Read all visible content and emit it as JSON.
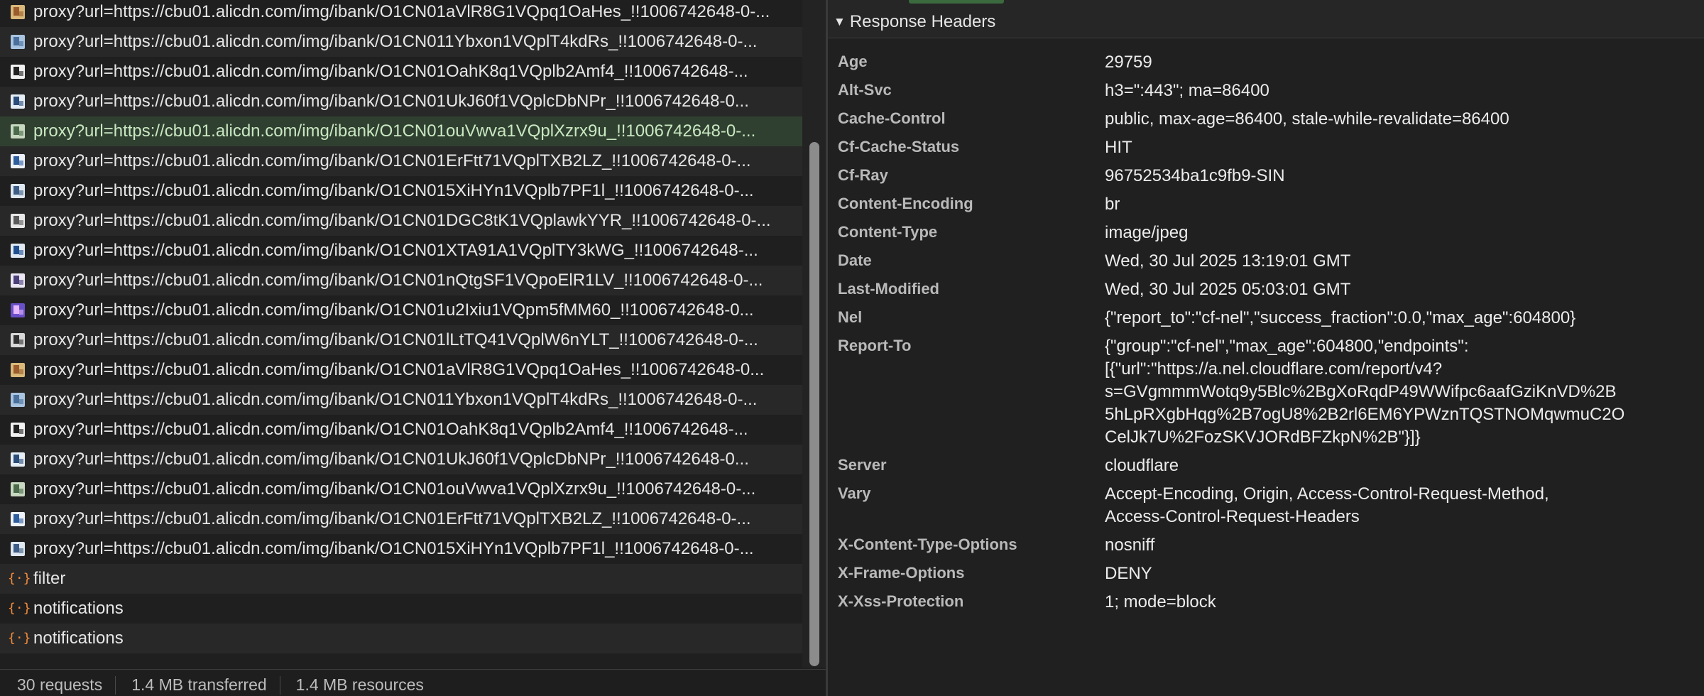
{
  "requests": [
    {
      "name": "proxy?url=https://cbu01.alicdn.com/img/ibank/O1CN01aVlR8G1VQpq1OaHes_!!1006742648-0-...",
      "icon": "image-thumb-icon"
    },
    {
      "name": "proxy?url=https://cbu01.alicdn.com/img/ibank/O1CN011Ybxon1VQplT4kdRs_!!1006742648-0-...",
      "icon": "image-thumb-icon"
    },
    {
      "name": "proxy?url=https://cbu01.alicdn.com/img/ibank/O1CN01OahK8q1VQplb2Amf4_!!1006742648-...",
      "icon": "image-thumb-icon"
    },
    {
      "name": "proxy?url=https://cbu01.alicdn.com/img/ibank/O1CN01UkJ60f1VQplcDbNPr_!!1006742648-0...",
      "icon": "image-thumb-icon"
    },
    {
      "name": "proxy?url=https://cbu01.alicdn.com/img/ibank/O1CN01ouVwva1VQplXzrx9u_!!1006742648-0-...",
      "icon": "image-thumb-icon"
    },
    {
      "name": "proxy?url=https://cbu01.alicdn.com/img/ibank/O1CN01ErFtt71VQplTXB2LZ_!!1006742648-0-...",
      "icon": "image-thumb-icon"
    },
    {
      "name": "proxy?url=https://cbu01.alicdn.com/img/ibank/O1CN015XiHYn1VQplb7PF1l_!!1006742648-0-...",
      "icon": "image-thumb-icon"
    },
    {
      "name": "proxy?url=https://cbu01.alicdn.com/img/ibank/O1CN01DGC8tK1VQplawkYYR_!!1006742648-0-...",
      "icon": "image-thumb-icon"
    },
    {
      "name": "proxy?url=https://cbu01.alicdn.com/img/ibank/O1CN01XTA91A1VQplTY3kWG_!!1006742648-...",
      "icon": "image-thumb-icon"
    },
    {
      "name": "proxy?url=https://cbu01.alicdn.com/img/ibank/O1CN01nQtgSF1VQpoElR1LV_!!1006742648-0-...",
      "icon": "image-thumb-icon"
    },
    {
      "name": "proxy?url=https://cbu01.alicdn.com/img/ibank/O1CN01u2Ixiu1VQpm5fMM60_!!1006742648-0...",
      "icon": "image-thumb-icon"
    },
    {
      "name": "proxy?url=https://cbu01.alicdn.com/img/ibank/O1CN01lLtTQ41VQplW6nYLT_!!1006742648-0-...",
      "icon": "image-thumb-icon"
    },
    {
      "name": "proxy?url=https://cbu01.alicdn.com/img/ibank/O1CN01aVlR8G1VQpq1OaHes_!!1006742648-0...",
      "icon": "image-thumb-icon"
    },
    {
      "name": "proxy?url=https://cbu01.alicdn.com/img/ibank/O1CN011Ybxon1VQplT4kdRs_!!1006742648-0-...",
      "icon": "image-thumb-icon"
    },
    {
      "name": "proxy?url=https://cbu01.alicdn.com/img/ibank/O1CN01OahK8q1VQplb2Amf4_!!1006742648-...",
      "icon": "image-thumb-icon"
    },
    {
      "name": "proxy?url=https://cbu01.alicdn.com/img/ibank/O1CN01UkJ60f1VQplcDbNPr_!!1006742648-0...",
      "icon": "image-thumb-icon"
    },
    {
      "name": "proxy?url=https://cbu01.alicdn.com/img/ibank/O1CN01ouVwva1VQplXzrx9u_!!1006742648-0-...",
      "icon": "image-thumb-icon"
    },
    {
      "name": "proxy?url=https://cbu01.alicdn.com/img/ibank/O1CN01ErFtt71VQplTXB2LZ_!!1006742648-0-...",
      "icon": "image-thumb-icon"
    },
    {
      "name": "proxy?url=https://cbu01.alicdn.com/img/ibank/O1CN015XiHYn1VQplb7PF1l_!!1006742648-0-...",
      "icon": "image-thumb-icon"
    },
    {
      "name": "filter",
      "icon": "json-braces-icon"
    },
    {
      "name": "notifications",
      "icon": "json-braces-icon"
    },
    {
      "name": "notifications",
      "icon": "json-braces-icon"
    }
  ],
  "selected_index": 4,
  "status_bar": {
    "requests": "30 requests",
    "transferred": "1.4 MB transferred",
    "resources": "1.4 MB resources"
  },
  "response_headers": {
    "title": "Response Headers",
    "items": [
      {
        "key": "Age",
        "value": "29759"
      },
      {
        "key": "Alt-Svc",
        "value": "h3=\":443\"; ma=86400"
      },
      {
        "key": "Cache-Control",
        "value": "public, max-age=86400, stale-while-revalidate=86400"
      },
      {
        "key": "Cf-Cache-Status",
        "value": "HIT"
      },
      {
        "key": "Cf-Ray",
        "value": "96752534ba1c9fb9-SIN"
      },
      {
        "key": "Content-Encoding",
        "value": "br"
      },
      {
        "key": "Content-Type",
        "value": "image/jpeg"
      },
      {
        "key": "Date",
        "value": "Wed, 30 Jul 2025 13:19:01 GMT"
      },
      {
        "key": "Last-Modified",
        "value": "Wed, 30 Jul 2025 05:03:01 GMT"
      },
      {
        "key": "Nel",
        "value": "{\"report_to\":\"cf-nel\",\"success_fraction\":0.0,\"max_age\":604800}"
      },
      {
        "key": "Report-To",
        "value": "{\"group\":\"cf-nel\",\"max_age\":604800,\"endpoints\":\n[{\"url\":\"https://a.nel.cloudflare.com/report/v4?\ns=GVgmmmWotq9y5Blc%2BgXoRqdP49WWifpc6aafGziKnVD%2B\n5hLpRXgbHqg%2B7ogU8%2B2rl6EM6YPWznTQSTNOMqwmuC2O\nCelJk7U%2FozSKVJORdBFZkpN%2B\"}]}"
      },
      {
        "key": "Server",
        "value": "cloudflare"
      },
      {
        "key": "Vary",
        "value": "Accept-Encoding, Origin, Access-Control-Request-Method,\nAccess-Control-Request-Headers"
      },
      {
        "key": "X-Content-Type-Options",
        "value": "nosniff"
      },
      {
        "key": "X-Frame-Options",
        "value": "DENY"
      },
      {
        "key": "X-Xss-Protection",
        "value": "1; mode=block"
      }
    ]
  },
  "colors": {
    "selected_row": "#304030",
    "json_icon": "#f08a3c",
    "accent_tab": "#3b6a3e"
  }
}
